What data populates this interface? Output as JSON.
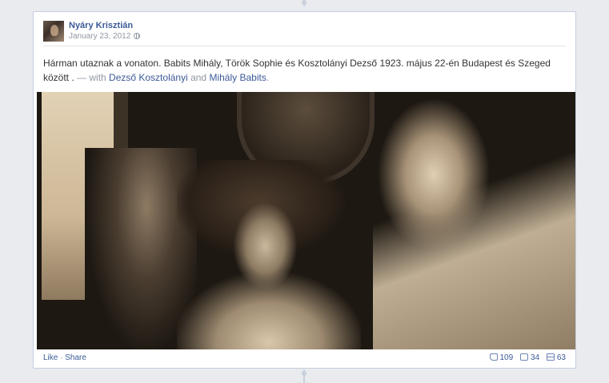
{
  "post": {
    "author": "Nyáry Krisztián",
    "date": "January 23, 2012",
    "text_main": "Hárman utaznak a vonaton. Babits Mihály, Török Sophie és Kosztolányi Dezső 1923. május 22-én Budapest és Szeged között .",
    "text_with": " — with ",
    "tagged_1": "Dezső Kosztolányi",
    "text_and": " and ",
    "tagged_2": "Mihály Babits",
    "text_end": "."
  },
  "footer": {
    "like": "Like",
    "separator": " · ",
    "share": "Share",
    "likes_count": "109",
    "comments_count": "34",
    "shares_count": "63"
  },
  "icons": {
    "privacy": "globe-icon",
    "likes": "thumbs-up-icon",
    "comments": "comment-icon",
    "shares": "share-icon"
  }
}
